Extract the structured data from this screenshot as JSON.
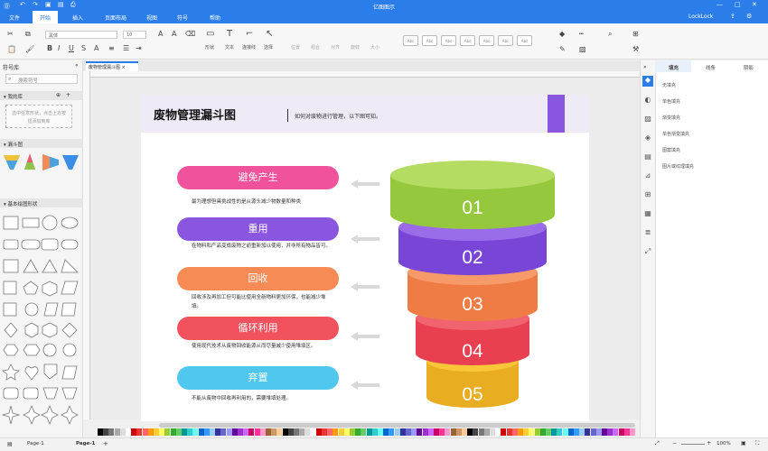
{
  "app": {
    "title": "亿图图示"
  },
  "menu": {
    "items": [
      "文件",
      "开始",
      "插入",
      "页面布局",
      "视图",
      "符号",
      "帮助"
    ],
    "user": "LockLock"
  },
  "toolbar": {
    "font_name": "黑体",
    "font_size": "10",
    "tools": [
      "形状",
      "文本",
      "连接线",
      "选择"
    ],
    "tools_right": [
      "位置",
      "组合",
      "对齐",
      "旋转",
      "大小"
    ],
    "style_swatches": [
      "Abc",
      "Abc",
      "Abc",
      "Abc",
      "Abc",
      "Abc",
      "Abc"
    ]
  },
  "library": {
    "title": "符号库",
    "search_placeholder": "搜索符号",
    "my_library": "我的库",
    "my_library_hint": "选中任意形状，点击上方按钮添加到库",
    "funnel_section": "漏斗图",
    "basic_section": "基本绘图形状"
  },
  "document": {
    "tab_label": "废物管理漏斗图"
  },
  "diagram": {
    "title": "废物管理漏斗图",
    "subtitle": "如何对废物进行管理，以下图可知。",
    "steps": [
      {
        "label": "避免产生",
        "desc": "最为理想但具挑战性的是从源头减少物数量和种类",
        "number": "01",
        "color": "#f0529c",
        "layer_color": "#a6d64e"
      },
      {
        "label": "重用",
        "desc": "在物料和产品变成废物之前重新加以使用，并非所有物品皆可。",
        "number": "02",
        "color": "#8a56e0",
        "layer_color": "#8a56e0"
      },
      {
        "label": "回收",
        "desc": "回收涉及再加工但可能比使用全新物料更加环保，也能减少堆填。",
        "number": "03",
        "color": "#f68b55",
        "layer_color": "#f68b55"
      },
      {
        "label": "循环利用",
        "desc": "使用现代技术从废物回收能源从而尽量减少使用堆填区。",
        "number": "04",
        "color": "#f2525e",
        "layer_color": "#f2525e"
      },
      {
        "label": "弃置",
        "desc": "不能从废物中回收再利用的，需要堆填处理。",
        "number": "05",
        "color": "#4fc7ef",
        "layer_color": "#fbc638"
      }
    ]
  },
  "right_panel": {
    "tabs": [
      "填充",
      "线条",
      "阴影"
    ],
    "fill_options": [
      "无填充",
      "单色填充",
      "渐变填充",
      "单色渐变填充",
      "图案填充",
      "图片或纹理填充"
    ]
  },
  "status": {
    "page_tab_1": "Page-1",
    "page_tab_2": "Page-1",
    "zoom": "100%"
  }
}
